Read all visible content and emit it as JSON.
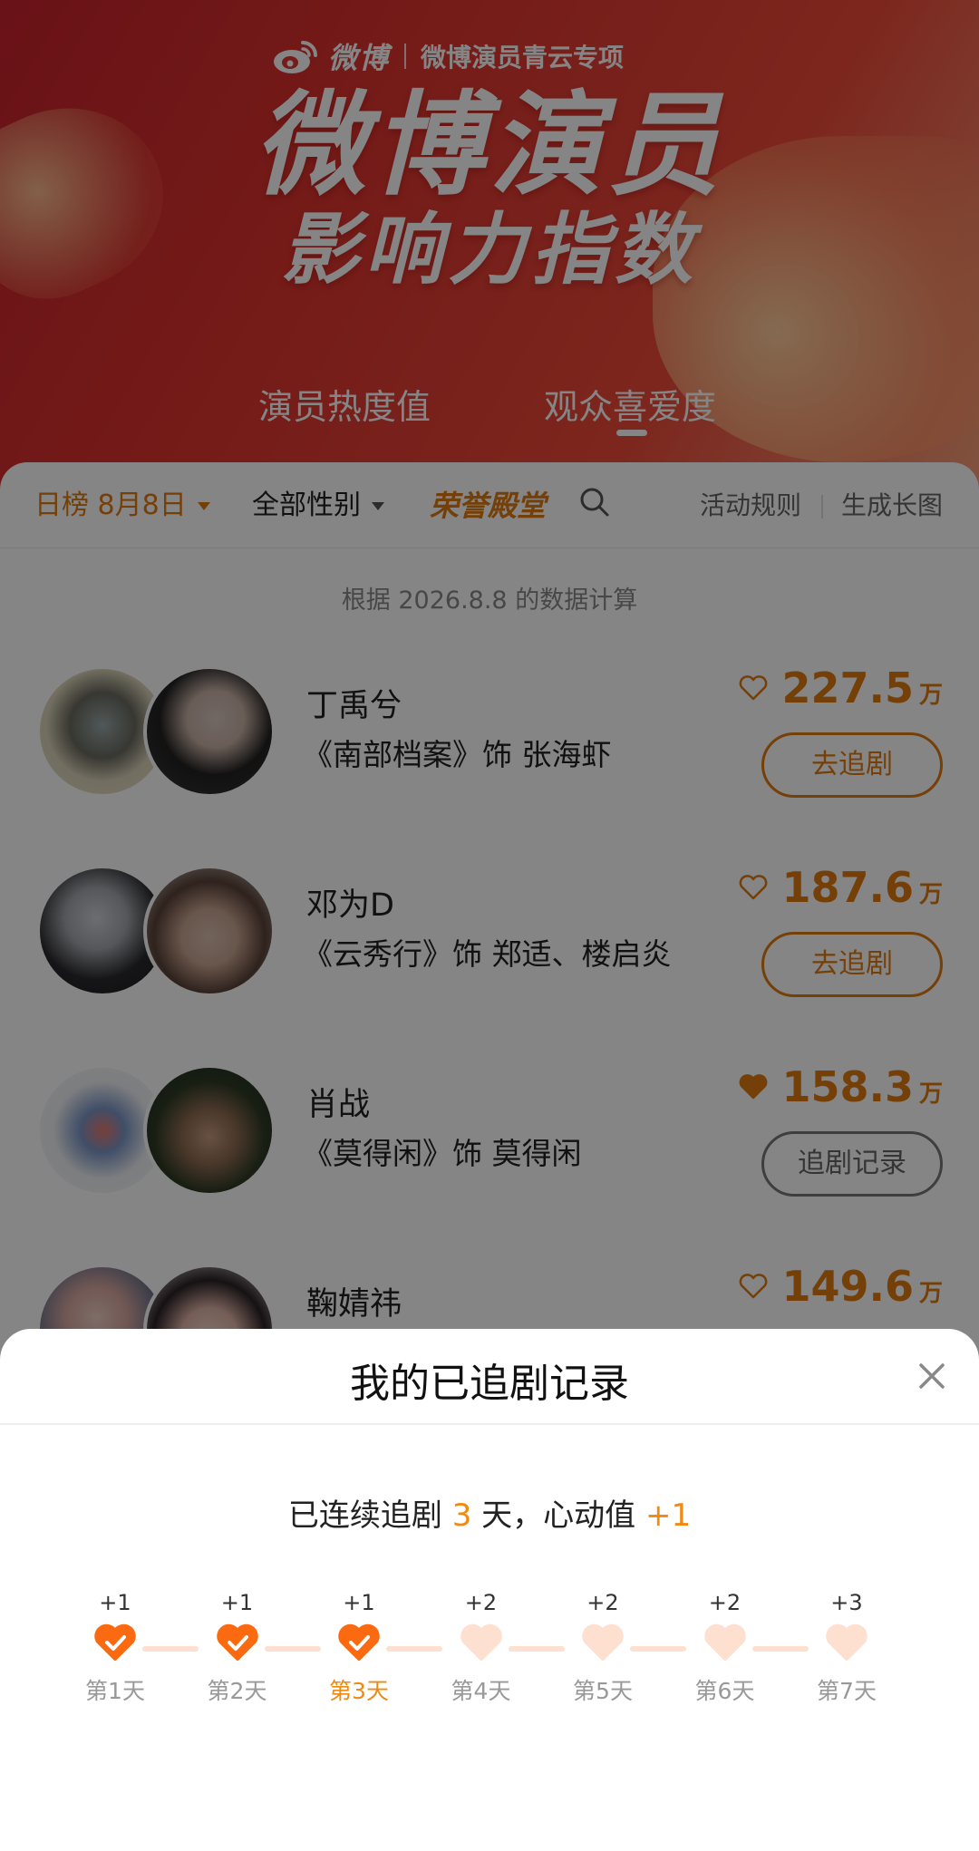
{
  "header": {
    "brand_weibo": "微博",
    "brand_sub": "微博演员青云专项",
    "title_line1": "微博演员",
    "title_line2": "影响力指数",
    "tabs": [
      "演员热度值",
      "观众喜爱度"
    ],
    "active_tab": 1
  },
  "filters": {
    "daily": "日榜 8月8日",
    "gender": "全部性别",
    "hall": "荣誉殿堂",
    "rules": "活动规则",
    "longimg": "生成长图"
  },
  "calc_note": "根据 2026.8.8 的数据计算",
  "colors": {
    "accent": "#e07a10",
    "header_red": "#e0352f",
    "streak_orange": "#f08a10"
  },
  "rows": [
    {
      "name": "丁禹兮",
      "role": "《南部档案》饰 张海虾",
      "score": "227.5",
      "unit": "万",
      "button": "去追剧",
      "liked": false
    },
    {
      "name": "邓为D",
      "role": "《云秀行》饰 郑适、楼启炎",
      "score": "187.6",
      "unit": "万",
      "button": "去追剧",
      "liked": false
    },
    {
      "name": "肖战",
      "role": "《莫得闲》饰 莫得闲",
      "score": "158.3",
      "unit": "万",
      "button": "追剧记录",
      "liked": true
    },
    {
      "name": "鞠婧祎",
      "role": "",
      "score": "149.6",
      "unit": "万",
      "button": "",
      "liked": false
    }
  ],
  "sheet": {
    "title": "我的已追剧记录",
    "streak_prefix": "已连续追剧",
    "streak_days": "3",
    "streak_mid": "天，心动值",
    "streak_bonus": "+1",
    "days": [
      {
        "plus": "+1",
        "label": "第1天",
        "done": true
      },
      {
        "plus": "+1",
        "label": "第2天",
        "done": true
      },
      {
        "plus": "+1",
        "label": "第3天",
        "done": true,
        "current": true
      },
      {
        "plus": "+2",
        "label": "第4天",
        "done": false
      },
      {
        "plus": "+2",
        "label": "第5天",
        "done": false
      },
      {
        "plus": "+2",
        "label": "第6天",
        "done": false
      },
      {
        "plus": "+3",
        "label": "第7天",
        "done": false
      }
    ]
  }
}
